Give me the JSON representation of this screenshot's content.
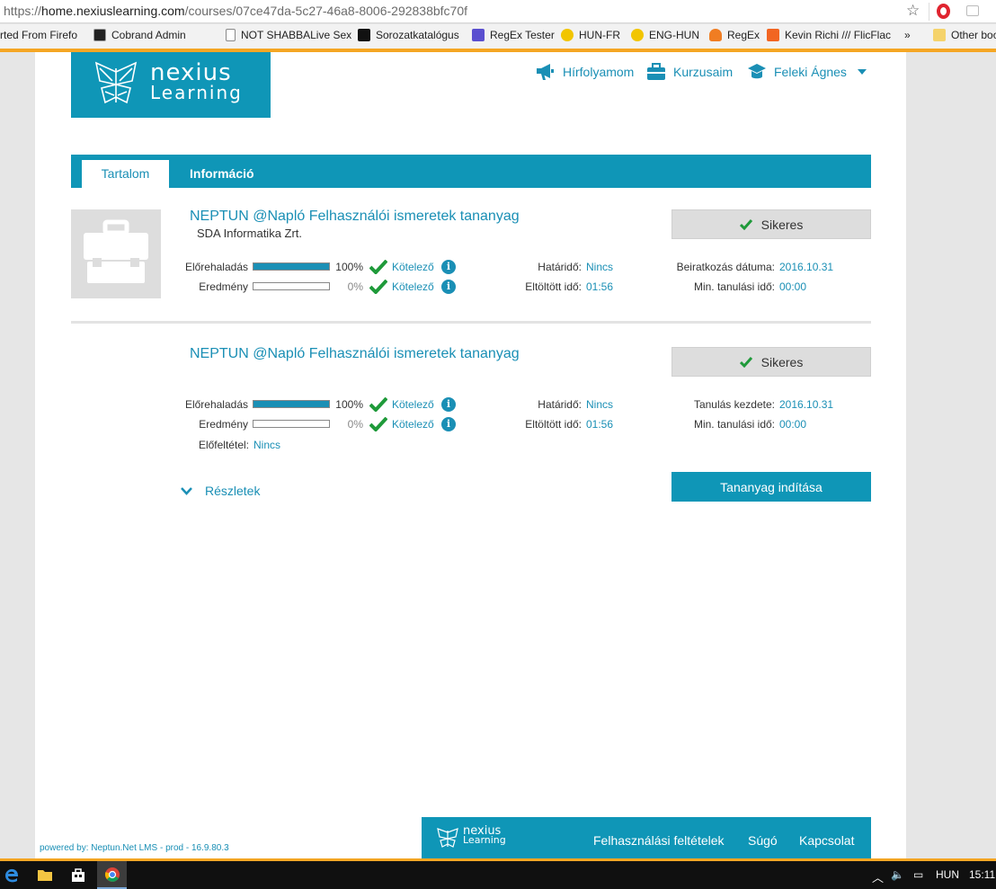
{
  "browser": {
    "url_scheme": "https://",
    "url_host": "home.nexiuslearning.com",
    "url_path": "/courses/07ce47da-5c27-46a8-8006-292838bfc70f",
    "bookmarks": [
      "rted From Firefo",
      "Cobrand Admin",
      "NOT SHABBALive Sex",
      "Sorozatkatalógus",
      "RegEx Tester",
      "HUN-FR",
      "ENG-HUN",
      "RegEx",
      "Kevin Richi /// FlicFlac",
      "»",
      "Other boo"
    ]
  },
  "brand": {
    "logo_line1": "nexius",
    "logo_line2": "Learning",
    "accent": "#0f96b7",
    "link_color": "#1a8fb5",
    "bar_color": "#f5a623"
  },
  "nav": {
    "feed": "Hírfolyamom",
    "courses": "Kurzusaim",
    "user": "Feleki Ágnes"
  },
  "tabs": {
    "content": "Tartalom",
    "info": "Információ"
  },
  "course": {
    "title": "NEPTUN @Napló Felhasználói ismeretek tananyag",
    "company": "SDA Informatika Zrt.",
    "status": "Sikeres",
    "progress_label": "Előrehaladás",
    "progress_value": 1.0,
    "progress_pct": "100%",
    "result_label": "Eredmény",
    "result_value": 0.0,
    "result_pct": "0%",
    "required": "Kötelező",
    "deadline_label": "Határidő:",
    "deadline_value": "Nincs",
    "spent_label": "Eltöltött idő:",
    "spent_value": "01:56",
    "enroll_label": "Beiratkozás dátuma:",
    "enroll_value": "2016.10.31",
    "min_label": "Min. tanulási idő:",
    "min_value": "00:00"
  },
  "material": {
    "title": "NEPTUN @Napló Felhasználói ismeretek tananyag",
    "status": "Sikeres",
    "progress_label": "Előrehaladás",
    "progress_value": 1.0,
    "progress_pct": "100%",
    "result_label": "Eredmény",
    "result_value": 0.0,
    "result_pct": "0%",
    "required": "Kötelező",
    "deadline_label": "Határidő:",
    "deadline_value": "Nincs",
    "spent_label": "Eltöltött idő:",
    "spent_value": "01:56",
    "start_label": "Tanulás kezdete:",
    "start_value": "2016.10.31",
    "min_label": "Min. tanulási idő:",
    "min_value": "00:00",
    "prereq_label": "Előfeltétel:",
    "prereq_value": "Nincs",
    "details": "Részletek",
    "start_button": "Tananyag indítása"
  },
  "footer": {
    "powered": "powered by: Neptun.Net LMS - prod - 16.9.80.3",
    "logo_line1": "nexius",
    "logo_line2": "Learning",
    "terms": "Felhasználási feltételek",
    "help": "Súgó",
    "contact": "Kapcsolat"
  },
  "taskbar": {
    "language": "HUN",
    "time": "15:11"
  }
}
